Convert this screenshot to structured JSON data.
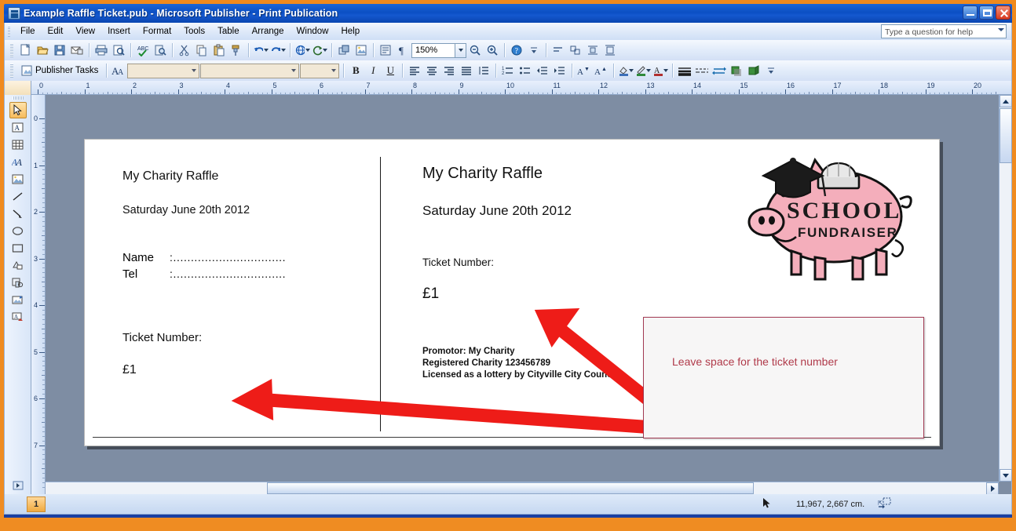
{
  "window": {
    "title": "Example Raffle Ticket.pub - Microsoft Publisher - Print Publication",
    "icon": "publisher-document-icon",
    "minimize_label": "Minimize",
    "maximize_label": "Restore",
    "close_label": "Close"
  },
  "menu": {
    "items": [
      {
        "label": "File"
      },
      {
        "label": "Edit"
      },
      {
        "label": "View"
      },
      {
        "label": "Insert"
      },
      {
        "label": "Format"
      },
      {
        "label": "Tools"
      },
      {
        "label": "Table"
      },
      {
        "label": "Arrange"
      },
      {
        "label": "Window"
      },
      {
        "label": "Help"
      }
    ],
    "help_box_placeholder": "Type a question for help"
  },
  "standard_toolbar": {
    "buttons": [
      {
        "name": "new-icon",
        "tip": "New"
      },
      {
        "name": "open-icon",
        "tip": "Open"
      },
      {
        "name": "save-icon",
        "tip": "Save"
      },
      {
        "name": "email-icon",
        "tip": "E-mail"
      },
      {
        "name": "print-icon",
        "tip": "Print"
      },
      {
        "name": "print-preview-icon",
        "tip": "Print Preview"
      },
      {
        "name": "spelling-icon",
        "tip": "Spelling"
      },
      {
        "name": "research-icon",
        "tip": "Research"
      },
      {
        "name": "cut-icon",
        "tip": "Cut"
      },
      {
        "name": "copy-icon",
        "tip": "Copy"
      },
      {
        "name": "paste-icon",
        "tip": "Paste"
      },
      {
        "name": "format-painter-icon",
        "tip": "Format Painter"
      },
      {
        "name": "undo-icon",
        "tip": "Undo"
      },
      {
        "name": "redo-icon",
        "tip": "Redo"
      },
      {
        "name": "insert-hyperlink-icon",
        "tip": "Insert Hyperlink"
      },
      {
        "name": "rotate-icon",
        "tip": "Rotate or Flip"
      },
      {
        "name": "bring-to-front-icon",
        "tip": "Bring to Front"
      },
      {
        "name": "design-gallery-icon",
        "tip": "Design Gallery Object"
      },
      {
        "name": "special-characters-icon",
        "tip": "Special Characters"
      },
      {
        "name": "zoom-out-icon",
        "tip": "Zoom Out"
      },
      {
        "name": "zoom-in-icon",
        "tip": "Zoom In"
      },
      {
        "name": "help-icon",
        "tip": "Microsoft Office Publisher Help"
      }
    ],
    "zoom_value": "150%"
  },
  "formatting_toolbar": {
    "publisher_tasks_label": "Publisher Tasks",
    "styles_value": "",
    "font_value": "",
    "font_size_value": "",
    "bold_label": "B",
    "italic_label": "I",
    "underline_label": "U",
    "grow_font_label": "A",
    "shrink_font_label": "A",
    "font_color_label": "A"
  },
  "objects_toolbar": {
    "items": [
      {
        "name": "select-objects-icon",
        "label": "Select Objects",
        "active": true
      },
      {
        "name": "text-box-icon",
        "label": "Text Box",
        "active": false
      },
      {
        "name": "insert-table-icon",
        "label": "Insert Table",
        "active": false
      },
      {
        "name": "wordart-icon",
        "label": "Insert WordArt",
        "active": false
      },
      {
        "name": "picture-frame-icon",
        "label": "Picture Frame",
        "active": false
      },
      {
        "name": "line-icon",
        "label": "Line",
        "active": false
      },
      {
        "name": "arrow-icon",
        "label": "Arrow",
        "active": false
      },
      {
        "name": "oval-icon",
        "label": "Oval",
        "active": false
      },
      {
        "name": "rectangle-icon",
        "label": "Rectangle",
        "active": false
      },
      {
        "name": "autoshapes-icon",
        "label": "AutoShapes",
        "active": false
      },
      {
        "name": "design-gallery-object-icon",
        "label": "Design Gallery Object",
        "active": false
      },
      {
        "name": "item-from-content-library-icon",
        "label": "Item from Content Library",
        "active": false
      },
      {
        "name": "add-to-content-library-icon",
        "label": "Add to Content Library",
        "active": false
      }
    ]
  },
  "rulers": {
    "horizontal_ticks": [
      "0",
      "1",
      "2",
      "3",
      "4",
      "5",
      "6",
      "7",
      "8",
      "9",
      "10",
      "11",
      "12",
      "13",
      "14",
      "15",
      "16",
      "17",
      "18",
      "19",
      "20"
    ],
    "vertical_ticks": [
      "0",
      "1",
      "2",
      "3",
      "4",
      "5",
      "6",
      "7"
    ],
    "units": "cm"
  },
  "ticket": {
    "stub": {
      "title": "My Charity Raffle",
      "date": "Saturday June 20th 2012",
      "name_label": "Name",
      "name_value": ":................................",
      "tel_label": "Tel",
      "tel_value": ":................................",
      "ticket_number_label": "Ticket Number:",
      "price": "£1"
    },
    "main": {
      "title": "My Charity Raffle",
      "date": "Saturday June 20th 2012",
      "ticket_number_label": "Ticket Number:",
      "price": "£1",
      "fine_print": [
        "Promotor: My Charity",
        "Registered Charity 123456789",
        "Licensed as a lottery by Cityville City Council"
      ]
    },
    "graphic": {
      "name": "piggy-bank-graduation-image",
      "word_primary": "SCHOOL",
      "word_secondary": "FUNDRAISER"
    }
  },
  "annotations": {
    "callout_text": "Leave space for the ticket number",
    "callout_color": "#b03a4a",
    "arrow_color": "#ee1c18",
    "arrows": [
      {
        "name": "annotation-arrow-left",
        "points_to": "stub ticket number"
      },
      {
        "name": "annotation-arrow-upper",
        "points_to": "main ticket number"
      }
    ]
  },
  "status_bar": {
    "page_number": "1",
    "coordinates": "11,967, 2,667 cm.",
    "object_size_icon": "object-position-size-icon"
  },
  "colors": {
    "title_bar": "#0b4fc4",
    "window_frame": "#f08a1d",
    "toolbar": "#dfeaf9",
    "canvas": "#7e8da3",
    "page": "#ffffff",
    "accent_red": "#ee1c18",
    "callout_border": "#a33b54",
    "pig_pink": "#f3a8b8"
  }
}
